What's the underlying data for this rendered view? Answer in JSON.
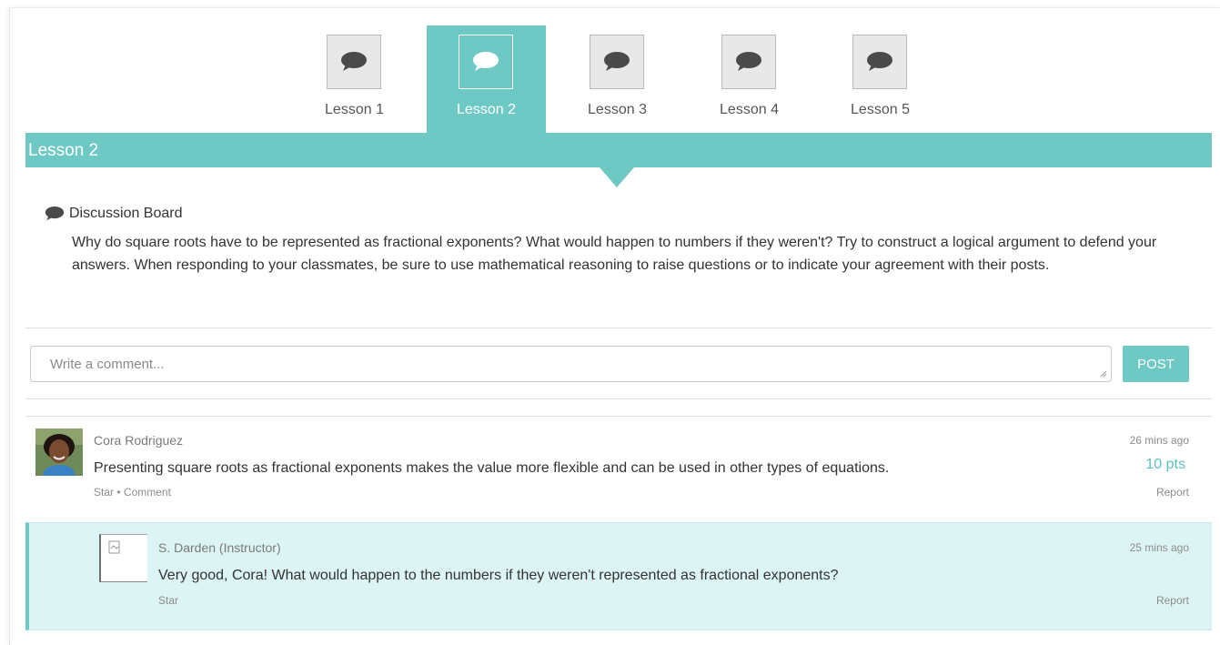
{
  "tabs": [
    {
      "label": "Lesson 1",
      "icon": "chat-bubble-icon",
      "active": false
    },
    {
      "label": "Lesson 2",
      "icon": "chat-bubble-icon",
      "active": true
    },
    {
      "label": "Lesson 3",
      "icon": "chat-bubble-icon",
      "active": false
    },
    {
      "label": "Lesson 4",
      "icon": "chat-bubble-icon",
      "active": false
    },
    {
      "label": "Lesson 5",
      "icon": "chat-bubble-icon",
      "active": false
    }
  ],
  "header": {
    "title": "Lesson 2"
  },
  "board": {
    "label": "Discussion Board",
    "icon": "chat-bubble-icon",
    "prompt": "Why do square roots have to be represented as fractional exponents? What would happen to numbers if they weren't? Try to construct a logical argument to defend your answers. When responding to your classmates, be sure to use mathematical reasoning to raise questions or to indicate your agreement with their posts."
  },
  "composer": {
    "placeholder": "Write a comment...",
    "post_label": "POST"
  },
  "comment": {
    "author": "Cora Rodriguez",
    "text": "Presenting square roots as fractional exponents makes the value more flexible and can be used in other types of equations.",
    "time": "26 mins ago",
    "points": "10 pts",
    "star": "Star",
    "separator": "•",
    "comment_action": "Comment",
    "report": "Report"
  },
  "reply": {
    "author": "S. Darden (Instructor)",
    "text": "Very good, Cora! What would happen to the numbers if they weren't represented as fractional exponents?",
    "time": "25 mins ago",
    "star": "Star",
    "report": "Report"
  },
  "colors": {
    "accent": "#6ec8c4",
    "reply_bg": "#dcf4f4",
    "points": "#5cc1bd"
  }
}
